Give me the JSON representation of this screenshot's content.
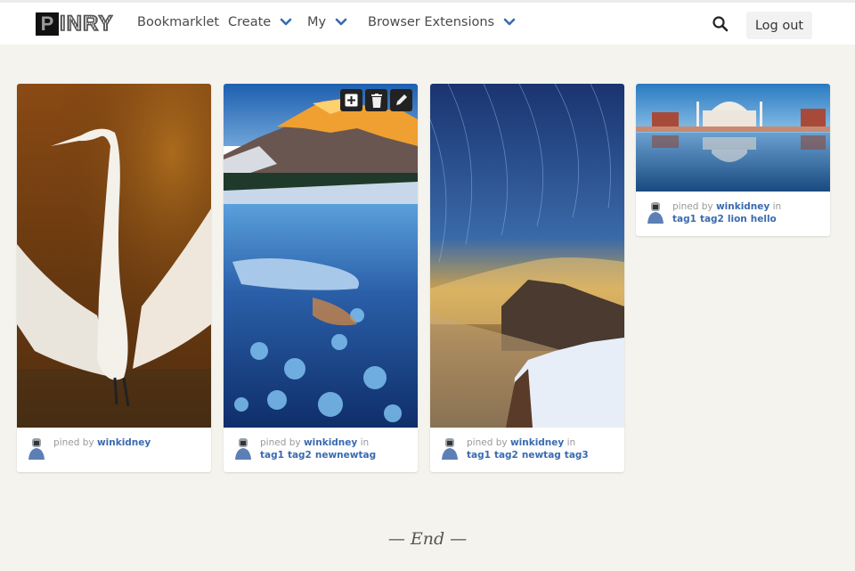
{
  "brand": {
    "logo_first": "P",
    "logo_rest": "INRY"
  },
  "nav": {
    "bookmarklet": "Bookmarklet",
    "create": "Create",
    "my": "My",
    "extensions": "Browser Extensions",
    "logout": "Log out",
    "accent": "#3a6ab0"
  },
  "pins": [
    {
      "image": "great egret spreading wings",
      "pined_by_label": "pined by",
      "user": "winkidney",
      "in_label": "",
      "tags": []
    },
    {
      "image": "frozen lake with mountain at sunrise",
      "pined_by_label": "pined by",
      "user": "winkidney",
      "in_label": "in",
      "tags": [
        "tag1",
        "tag2",
        "newnewtag"
      ],
      "actions": [
        "add",
        "delete",
        "edit"
      ]
    },
    {
      "image": "star trails over mountain peak",
      "pined_by_label": "pined by",
      "user": "winkidney",
      "in_label": "in",
      "tags": [
        "tag1",
        "tag2",
        "newtag",
        "tag3"
      ]
    },
    {
      "image": "Taj Mahal reflection",
      "pined_by_label": "pined by",
      "user": "winkidney",
      "in_label": "in",
      "tags": [
        "tag1",
        "tag2",
        "lion",
        "hello"
      ]
    }
  ],
  "footer": {
    "end_text": "— End —"
  }
}
